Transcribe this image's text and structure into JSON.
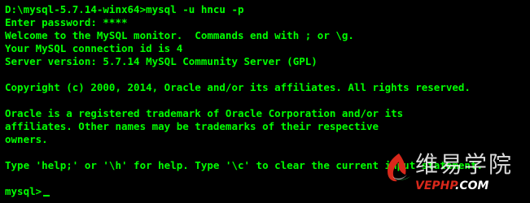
{
  "terminal": {
    "lines": [
      "D:\\mysql-5.7.14-winx64>mysql -u hncu -p",
      "Enter password: ****",
      "Welcome to the MySQL monitor.  Commands end with ; or \\g.",
      "Your MySQL connection id is 4",
      "Server version: 5.7.14 MySQL Community Server (GPL)",
      "",
      "Copyright (c) 2000, 2014, Oracle and/or its affiliates. All rights reserved.",
      "",
      "Oracle is a registered trademark of Oracle Corporation and/or its",
      "affiliates. Other names may be trademarks of their respective",
      "owners.",
      "",
      "Type 'help;' or '\\h' for help. Type '\\c' to clear the current input statement.",
      "",
      "mysql>"
    ],
    "text_color": "#00ff00",
    "background_color": "#000000"
  },
  "watermark": {
    "chinese": "维易学院",
    "url_accent": "VEPHP",
    "url_rest": ".COM"
  }
}
